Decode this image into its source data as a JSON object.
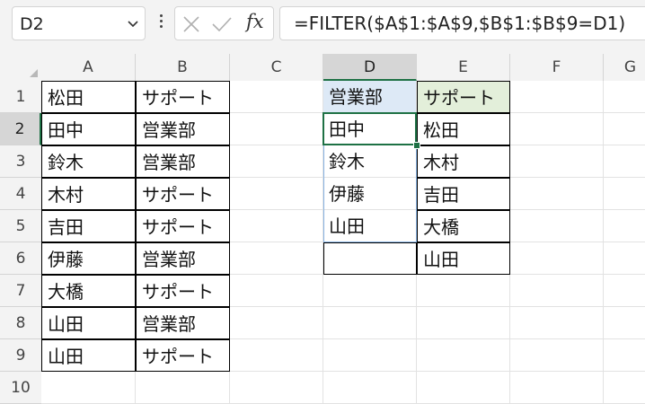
{
  "formula_bar": {
    "name_box": "D2",
    "fx_label": "fx",
    "formula": "=FILTER($A$1:$A$9,$B$1:$B$9=D1)"
  },
  "columns": [
    "A",
    "B",
    "C",
    "D",
    "E",
    "F",
    "G"
  ],
  "rows": [
    "1",
    "2",
    "3",
    "4",
    "5",
    "6",
    "7",
    "8",
    "9",
    "10"
  ],
  "cells": {
    "A": [
      "松田",
      "田中",
      "鈴木",
      "木村",
      "吉田",
      "伊藤",
      "大橋",
      "山田",
      "山田"
    ],
    "B": [
      "サポート",
      "営業部",
      "営業部",
      "サポート",
      "サポート",
      "営業部",
      "サポート",
      "営業部",
      "サポート"
    ],
    "D": [
      "営業部",
      "田中",
      "鈴木",
      "伊藤",
      "山田"
    ],
    "E": [
      "サポート",
      "松田",
      "木村",
      "吉田",
      "大橋",
      "山田"
    ]
  },
  "selected_cell": "D2"
}
